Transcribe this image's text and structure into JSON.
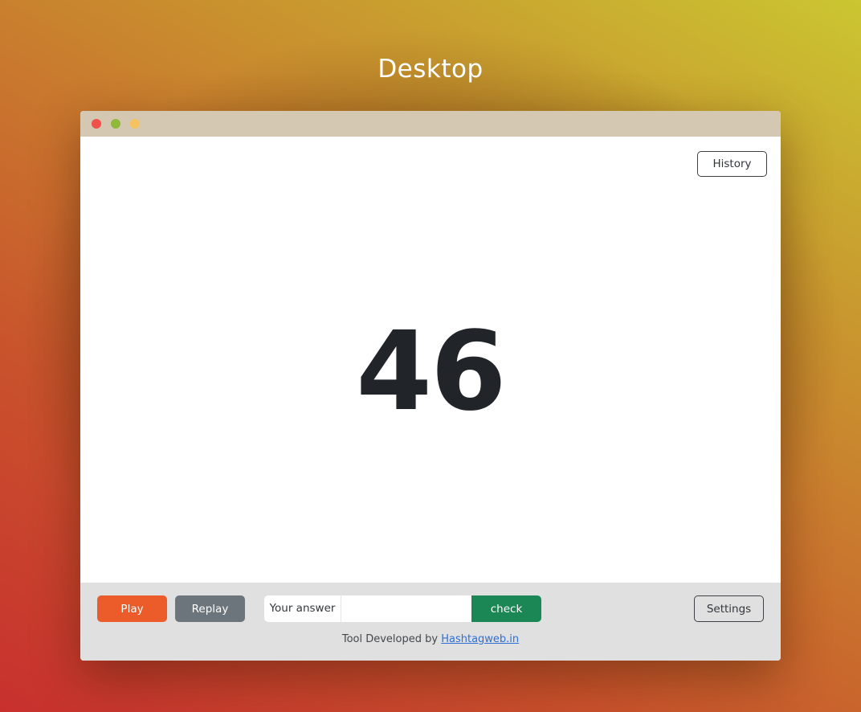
{
  "page": {
    "heading": "Desktop"
  },
  "window": {
    "controls": [
      "close",
      "minimize",
      "maximize"
    ]
  },
  "main": {
    "history_label": "History",
    "number": "46"
  },
  "footer": {
    "play_label": "Play",
    "replay_label": "Replay",
    "answer_label": "Your answer",
    "answer_value": "",
    "check_label": "check",
    "settings_label": "Settings",
    "credit_prefix": "Tool Developed by ",
    "credit_link": "Hashtagweb.in"
  },
  "colors": {
    "play": "#eb5c2a",
    "replay": "#6c757c",
    "check": "#1a8754",
    "link": "#2d6fd6"
  }
}
